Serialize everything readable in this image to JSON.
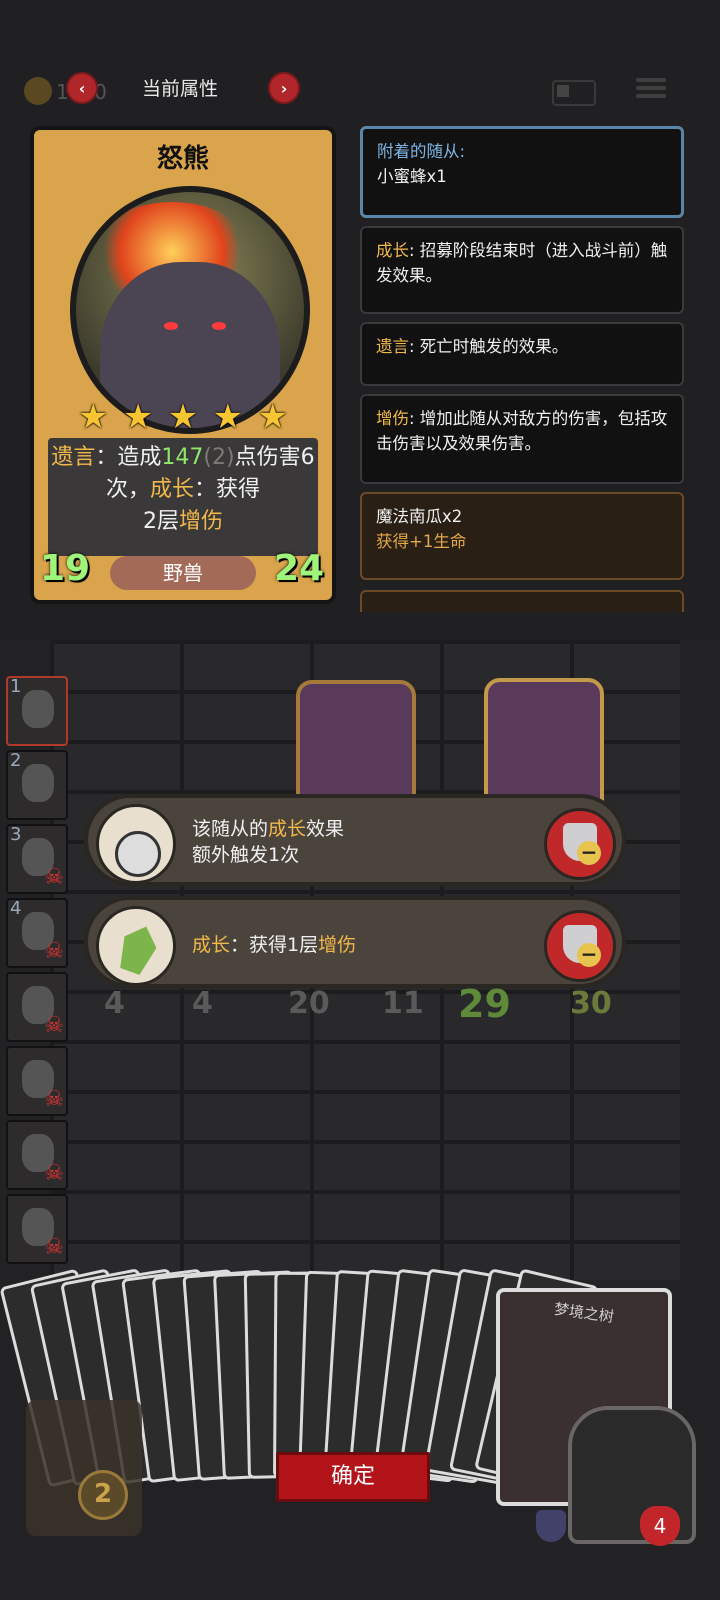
{
  "top_bar": {
    "coin_value": "1120",
    "title": "当前属性",
    "prev": "‹",
    "next": "›"
  },
  "card": {
    "name": "怒熊",
    "stars": [
      "★",
      "★",
      "★",
      "★",
      "★"
    ],
    "desc_kw1": "遗言",
    "desc_1": "：造成",
    "desc_num": "147",
    "desc_num2": "(2)",
    "desc_2": "点伤害6次，",
    "desc_kw2": "成长",
    "desc_3": "：获得",
    "desc_4": "2层",
    "desc_kw3": "增伤",
    "attack": "19",
    "health": "24",
    "tribe": "野兽"
  },
  "keywords": {
    "attached_label": "附着的随从:",
    "attached_value": "小蜜蜂x1",
    "grow_label": "成长",
    "grow_text": ": 招募阶段结束时（进入战斗前）触发效果。",
    "death_label": "遗言",
    "death_text": ": 死亡时触发的效果。",
    "dmg_label": "增伤",
    "dmg_text": ": 增加此随从对敌方的伤害，包括攻击伤害以及效果伤害。",
    "item_name": "魔法南瓜x2",
    "item_effect": "获得+1生命"
  },
  "slots": [
    "1",
    "2",
    "3",
    "4"
  ],
  "board": {
    "stats": [
      "4",
      "4",
      "20",
      "11",
      "29",
      "30"
    ]
  },
  "popups": [
    {
      "pre": "该随从的",
      "kw": "成长",
      "post": "效果",
      "line2": "额外触发1次"
    },
    {
      "kw": "成长",
      "post": "：获得1层",
      "kw2": "增伤"
    }
  ],
  "bottom": {
    "confirm_label": "确定",
    "tree_card_name": "梦境之树",
    "coin_count": "2",
    "hero_health": "4"
  },
  "colors": {
    "keyword_gold": "#f1b84a",
    "value_green": "#8fe86a",
    "confirm_red": "#b3141a"
  }
}
